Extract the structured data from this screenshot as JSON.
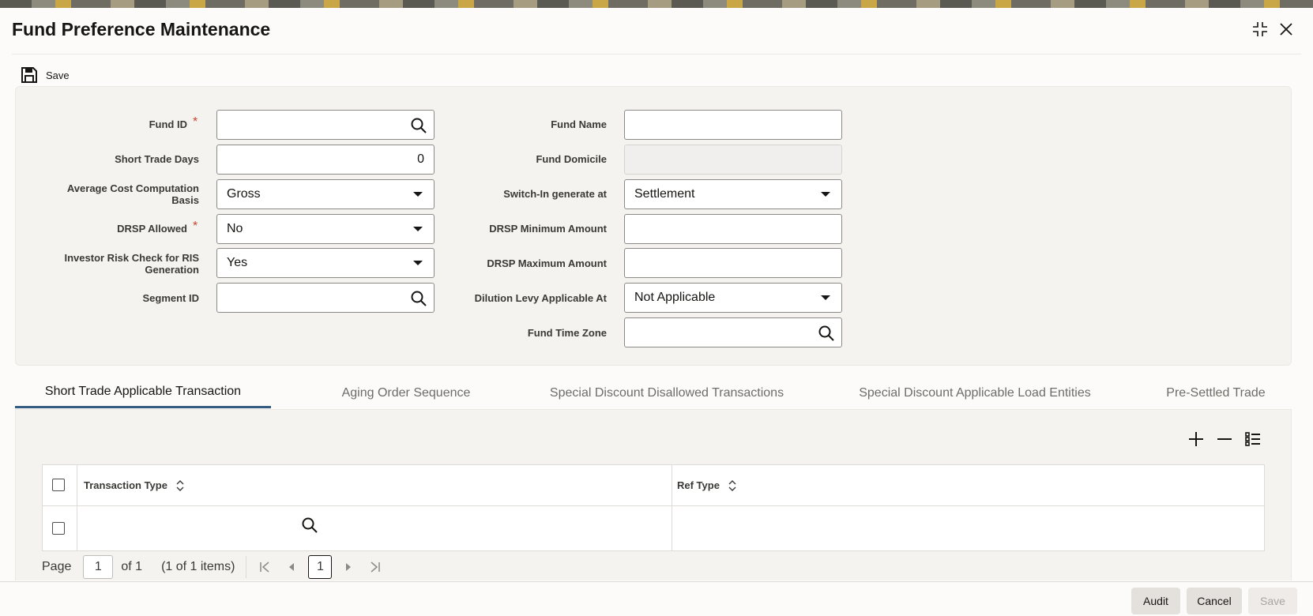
{
  "window": {
    "title": "Fund Preference Maintenance"
  },
  "toolbar": {
    "save_label": "Save"
  },
  "form": {
    "fund_id": {
      "label": "Fund ID",
      "value": ""
    },
    "fund_name": {
      "label": "Fund Name",
      "value": ""
    },
    "short_trade_days": {
      "label": "Short Trade Days",
      "value": "0"
    },
    "fund_domicile": {
      "label": "Fund Domicile",
      "value": ""
    },
    "avg_cost_basis": {
      "label_line1": "Average Cost Computation",
      "label_line2": "Basis",
      "value": "Gross"
    },
    "switch_in_generate_at": {
      "label": "Switch-In generate at",
      "value": "Settlement"
    },
    "drsp_allowed": {
      "label": "DRSP Allowed",
      "value": "No"
    },
    "drsp_min_amount": {
      "label": "DRSP Minimum Amount",
      "value": ""
    },
    "investor_risk_check": {
      "label_line1": "Investor Risk Check for RIS",
      "label_line2": "Generation",
      "value": "Yes"
    },
    "drsp_max_amount": {
      "label": "DRSP Maximum Amount",
      "value": ""
    },
    "segment_id": {
      "label": "Segment ID",
      "value": ""
    },
    "dilution_levy": {
      "label": "Dilution Levy Applicable At",
      "value": "Not Applicable"
    },
    "fund_time_zone": {
      "label": "Fund Time Zone",
      "value": ""
    },
    "required_marker": "*"
  },
  "tabs": [
    {
      "label": "Short Trade Applicable Transaction",
      "active": true
    },
    {
      "label": "Aging Order Sequence",
      "active": false
    },
    {
      "label": "Special Discount Disallowed Transactions",
      "active": false
    },
    {
      "label": "Special Discount Applicable Load Entities",
      "active": false
    },
    {
      "label": "Pre-Settled Trade",
      "active": false
    }
  ],
  "grid": {
    "columns": [
      "Transaction Type",
      "Ref Type"
    ]
  },
  "pager": {
    "page_label": "Page",
    "page_value": "1",
    "of_label": "of 1",
    "items_label": "(1 of 1 items)",
    "current_page": "1"
  },
  "footer": {
    "audit_label": "Audit",
    "cancel_label": "Cancel",
    "save_label": "Save"
  },
  "colors": {
    "accent": "#335a80",
    "required": "#c74634"
  }
}
